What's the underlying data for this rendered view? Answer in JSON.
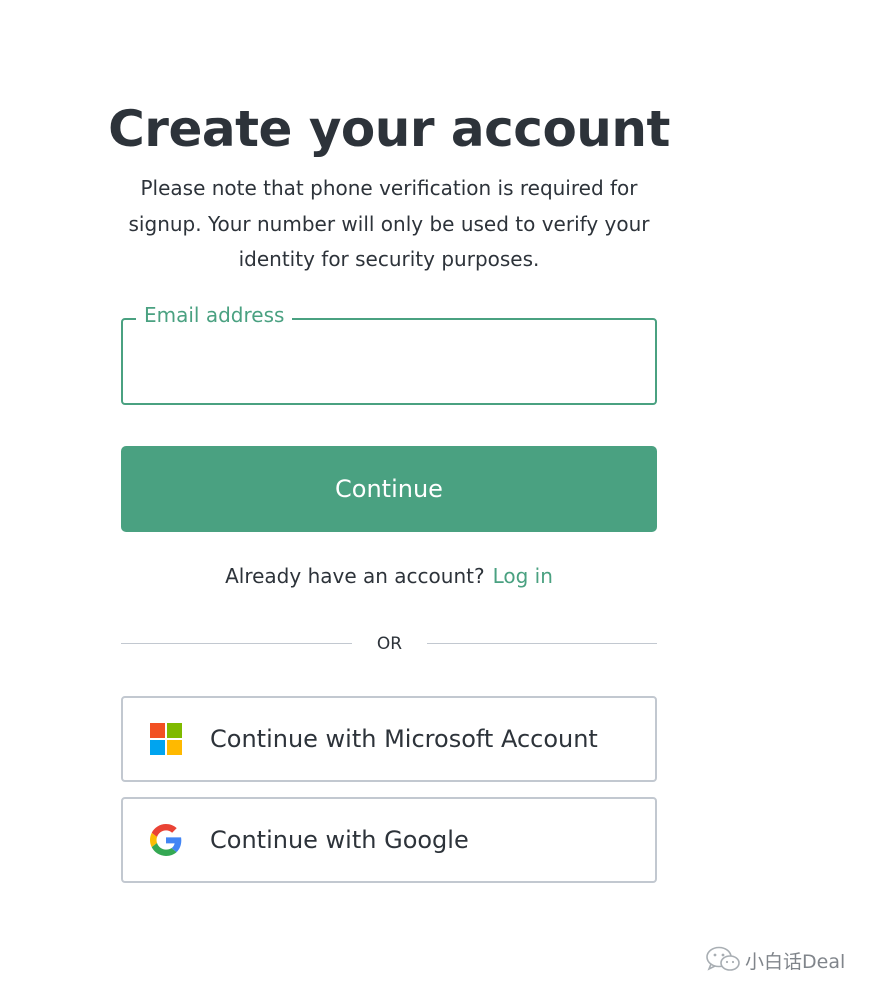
{
  "header": {
    "title": "Create your account",
    "subtitle": "Please note that phone verification is required for signup. Your number will only be used to verify your identity for security purposes."
  },
  "form": {
    "email_label": "Email address",
    "email_value": "",
    "email_placeholder": "",
    "continue_label": "Continue"
  },
  "login": {
    "prompt": "Already have an account?",
    "link_label": "Log in"
  },
  "divider": {
    "label": "OR"
  },
  "social": {
    "microsoft_label": "Continue with Microsoft Account",
    "microsoft_icon": "microsoft-logo-icon",
    "google_label": "Continue with Google",
    "google_icon": "google-logo-icon"
  },
  "watermark": {
    "text": "小白话Deal",
    "icon": "wechat-icon"
  },
  "colors": {
    "accent": "#4aa181",
    "text": "#2d333a",
    "border": "#c2c8d0"
  }
}
